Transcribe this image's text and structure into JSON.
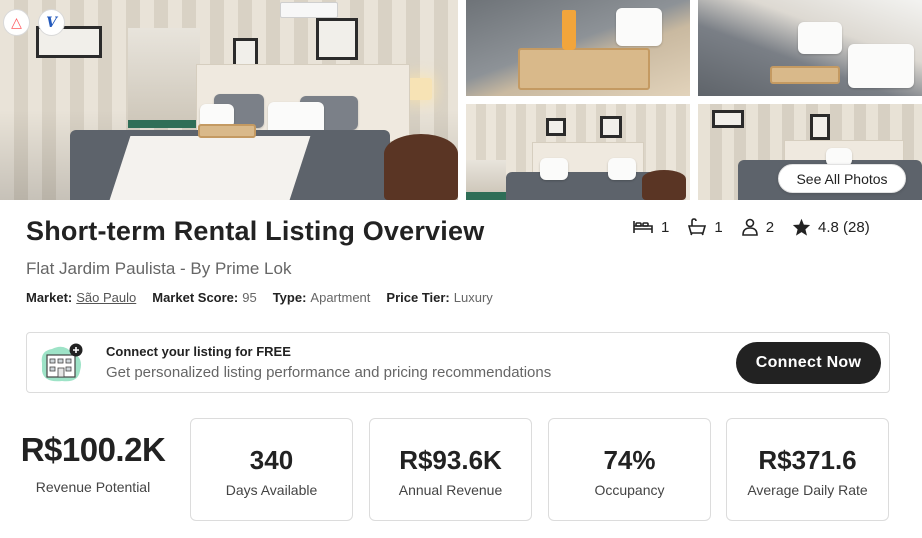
{
  "gallery": {
    "see_all_label": "See All Photos",
    "badges": [
      {
        "icon": "airbnb-logo-icon",
        "glyph": "△"
      },
      {
        "icon": "vrbo-logo-icon",
        "glyph": "V"
      }
    ]
  },
  "listing": {
    "title": "Short-term Rental Listing Overview",
    "name": "Flat Jardim Paulista - By Prime Lok",
    "meta": {
      "market_label": "Market:",
      "market_value": "São Paulo",
      "score_label": "Market Score:",
      "score_value": "95",
      "type_label": "Type:",
      "type_value": "Apartment",
      "tier_label": "Price Tier:",
      "tier_value": "Luxury"
    },
    "amenities": {
      "bedrooms": "1",
      "bathrooms": "1",
      "guests": "2",
      "rating": "4.8 (28)"
    }
  },
  "banner": {
    "title": "Connect your listing for FREE",
    "text": "Get personalized listing performance and pricing recommendations",
    "button_label": "Connect Now"
  },
  "stats": {
    "revenue_potential": {
      "value": "R$100.2K",
      "label": "Revenue Potential"
    },
    "cards": [
      {
        "value": "340",
        "label": "Days Available"
      },
      {
        "value": "R$93.6K",
        "label": "Annual Revenue"
      },
      {
        "value": "74%",
        "label": "Occupancy"
      },
      {
        "value": "R$371.6",
        "label": "Average Daily Rate"
      }
    ]
  },
  "colors": {
    "primary_button": "#222222",
    "banner_icon_bg": "#9ee3c7",
    "airbnb": "#ff5a5f"
  }
}
